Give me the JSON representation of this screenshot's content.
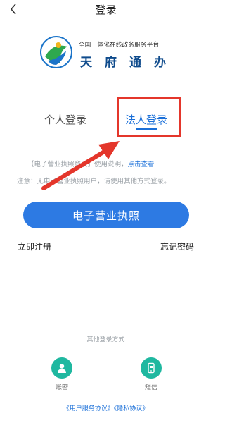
{
  "nav": {
    "title": "登录"
  },
  "logo": {
    "subtitle": "全国一体化在线政务服务平台",
    "name": "天府通办"
  },
  "tabs": [
    {
      "label": "个人登录",
      "active": false
    },
    {
      "label": "法人登录",
      "active": true
    }
  ],
  "info": {
    "line1_prefix": "【电子营业执照登录】使用说明，",
    "line1_link": "点击查看",
    "line2": "注意：无电子营业执照用户，请使用其他方式登录。"
  },
  "primary_button": {
    "label": "电子营业执照"
  },
  "links": {
    "register": "立即注册",
    "forgot": "忘记密码"
  },
  "other_login": {
    "title": "其他登录方式",
    "methods": [
      {
        "label": "账密",
        "icon": "user-icon"
      },
      {
        "label": "短信",
        "icon": "phone-sms-icon"
      }
    ]
  },
  "agreements": {
    "user": "《用户服务协议》",
    "privacy": "《隐私协议》"
  },
  "colors": {
    "accent": "#2d7ae3",
    "tab_active": "#1a6fd8",
    "annotation": "#e4362b",
    "method": "#1fb8a0"
  }
}
